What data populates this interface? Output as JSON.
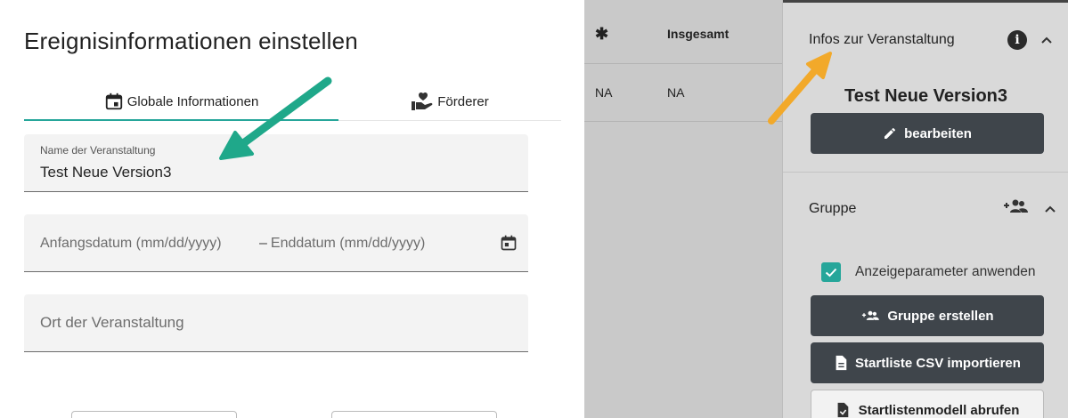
{
  "dialog": {
    "title": "Ereignisinformationen einstellen",
    "tabs": [
      {
        "label": "Globale Informationen",
        "icon": "calendar-icon",
        "active": true
      },
      {
        "label": "Förderer",
        "icon": "hand-heart-icon",
        "active": false
      }
    ],
    "fields": {
      "name": {
        "label": "Name der Veranstaltung",
        "value": "Test Neue Version3"
      },
      "date": {
        "start_placeholder": "Anfangsdatum (mm/dd/yyyy)",
        "separator": "–",
        "end_placeholder": "Enddatum (mm/dd/yyyy)",
        "icon": "calendar-icon"
      },
      "ort": {
        "placeholder": "Ort der Veranstaltung"
      }
    },
    "accent_color": "#26a69a"
  },
  "table": {
    "headers": [
      "✱",
      "Insgesamt"
    ],
    "rows": [
      [
        "NA",
        "NA"
      ]
    ]
  },
  "panel": {
    "infos": {
      "title": "Infos zur Veranstaltung",
      "info_icon": "i",
      "event_name": "Test Neue Version3",
      "edit_button": "bearbeiten"
    },
    "gruppe": {
      "title": "Gruppe",
      "checkbox_label": "Anzeigeparameter anwenden",
      "checkbox_checked": true,
      "create_button": "Gruppe erstellen",
      "import_button": "Startliste CSV importieren",
      "template_button": "Startlistenmodell abrufen"
    },
    "button_color": "#3f454b"
  },
  "annotations": {
    "green_arrow_color": "#1fa88a",
    "orange_arrow_color": "#f2a92a"
  }
}
